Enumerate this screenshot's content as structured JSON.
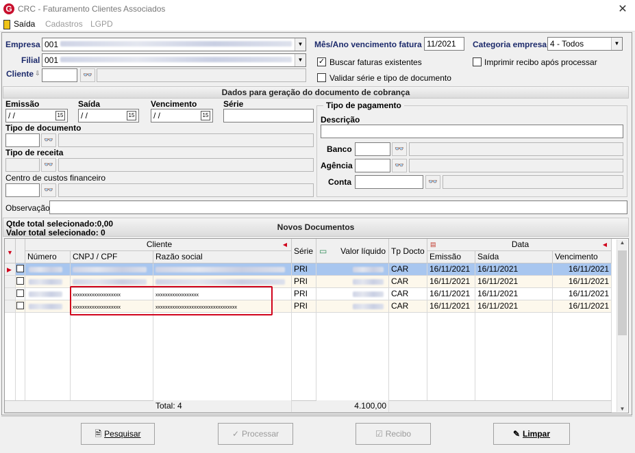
{
  "window": {
    "title": "CRC - Faturamento Clientes Associados",
    "close": "✕"
  },
  "menu": {
    "saida": "Saída",
    "cadastros": "Cadastros",
    "lgpd": "LGPD"
  },
  "form": {
    "empresa_label": "Empresa",
    "empresa_code": "001",
    "filial_label": "Filial",
    "filial_code": "001",
    "cliente_label": "Cliente",
    "mes_ano_label": "Mês/Ano vencimento fatura",
    "mes_ano_value": "11/2021",
    "categoria_label": "Categoria empresa",
    "categoria_value": "4 - Todos",
    "buscar_label": "Buscar faturas existentes",
    "imprimir_label": "Imprimir recibo após processar",
    "validar_label": "Validar série e tipo de documento"
  },
  "doc_section": {
    "header": "Dados para geração do documento de cobrança",
    "emissao_label": "Emissão",
    "saida_label": "Saída",
    "vencimento_label": "Vencimento",
    "serie_label": "Série",
    "date_placeholder": " / /",
    "tipo_documento_label": "Tipo de documento",
    "tipo_receita_label": "Tipo de receita",
    "centro_custos_label": "Centro de custos financeiro",
    "observacao_label": "Observação",
    "tipo_pagamento_label": "Tipo de pagamento",
    "descricao_label": "Descrição",
    "banco_label": "Banco",
    "agencia_label": "Agência",
    "conta_label": "Conta"
  },
  "novos": {
    "header": "Novos Documentos",
    "qtde": "Qtde total selecionado:0,00",
    "valor": "Valor total selecionado: 0"
  },
  "grid": {
    "group_cliente": "Cliente",
    "group_data": "Data",
    "col_numero": "Número",
    "col_cnpj": "CNPJ / CPF",
    "col_razao": "Razão social",
    "col_serie": "Série",
    "col_valor": "Valor líquido",
    "col_tpdocto": "Tp Docto",
    "col_emissao": "Emissão",
    "col_saida": "Saída",
    "col_vencimento": "Vencimento",
    "rows": [
      {
        "cnpj": "",
        "razao": "",
        "serie": "PRI",
        "tp": "CAR",
        "emissao": "16/11/2021",
        "saida": "16/11/2021",
        "venc": "16/11/2021"
      },
      {
        "cnpj": "",
        "razao": "",
        "serie": "PRI",
        "tp": "CAR",
        "emissao": "16/11/2021",
        "saida": "16/11/2021",
        "venc": "16/11/2021"
      },
      {
        "cnpj": "xxxxxxxxxxxxxxxxxxxx",
        "razao": "xxxxxxxxxxxxxxxxxx",
        "serie": "PRI",
        "tp": "CAR",
        "emissao": "16/11/2021",
        "saida": "16/11/2021",
        "venc": "16/11/2021"
      },
      {
        "cnpj": "xxxxxxxxxxxxxxxxxxxx",
        "razao": "xxxxxxxxxxxxxxxxxxxxxxxxxxxxxxxxxx",
        "serie": "PRI",
        "tp": "CAR",
        "emissao": "16/11/2021",
        "saida": "16/11/2021",
        "venc": "16/11/2021"
      }
    ],
    "footer_total": "Total: 4",
    "footer_valor": "4.100,00"
  },
  "buttons": {
    "pesquisar": "Pesquisar",
    "processar": "Processar",
    "recibo": "Recibo",
    "limpar": "Limpar"
  },
  "colors": {
    "accent": "#1c2a6b",
    "selected_row": "#a8c6ef",
    "highlight": "#d0021b"
  }
}
